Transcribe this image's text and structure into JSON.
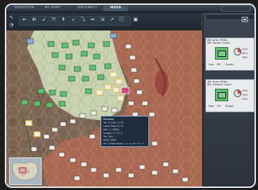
{
  "tabs": [
    {
      "label": "OPERATION"
    },
    {
      "label": "MY ARMY"
    },
    {
      "label": "DIPLOMACY"
    },
    {
      "label": "MOVE"
    }
  ],
  "active_tab": "MOVE",
  "right_panel": {
    "unit1": {
      "name": "8th Army Rifles",
      "sub": "BR. Panzer Corps",
      "stats": [
        "42%",
        "89%",
        "36%"
      ],
      "labels": [
        "Orgs",
        "Eff.",
        "Supply"
      ]
    },
    "unit2": {
      "name": "4th Army Rifles",
      "sub": "BR. Infantry Corps",
      "stats": [
        "23%",
        "31%",
        "55%"
      ],
      "labels": [
        "Orgs",
        "Eff.",
        "Supply"
      ]
    }
  },
  "popup": {
    "lines": [
      "Paradom",
      "Trn: 5 / Ab: 1 / M",
      "Land: Mov: 6 / B",
      "Pwr: 1 / BRSL",
      "Supply: 1 / 5 / 4",
      "Trn Ctrl: ...",
      "Infra: Skld",
      "Brd: 2 Rifled Regim... 2 / 3 / 40 / 37 / 2"
    ]
  },
  "colors": {
    "friendly_zone": "#d8e6c2",
    "enemy_hex": "#b86a52",
    "counter_green": "#5fbf6e",
    "counter_white": "#f0eee6",
    "panel_bg": "#2c333c",
    "enemy_unit": "#d24a7a"
  },
  "icons": [
    "move-arrow-icon",
    "attack-icon",
    "zoom-icon",
    "unit-counter-icon",
    "corner-icon"
  ]
}
